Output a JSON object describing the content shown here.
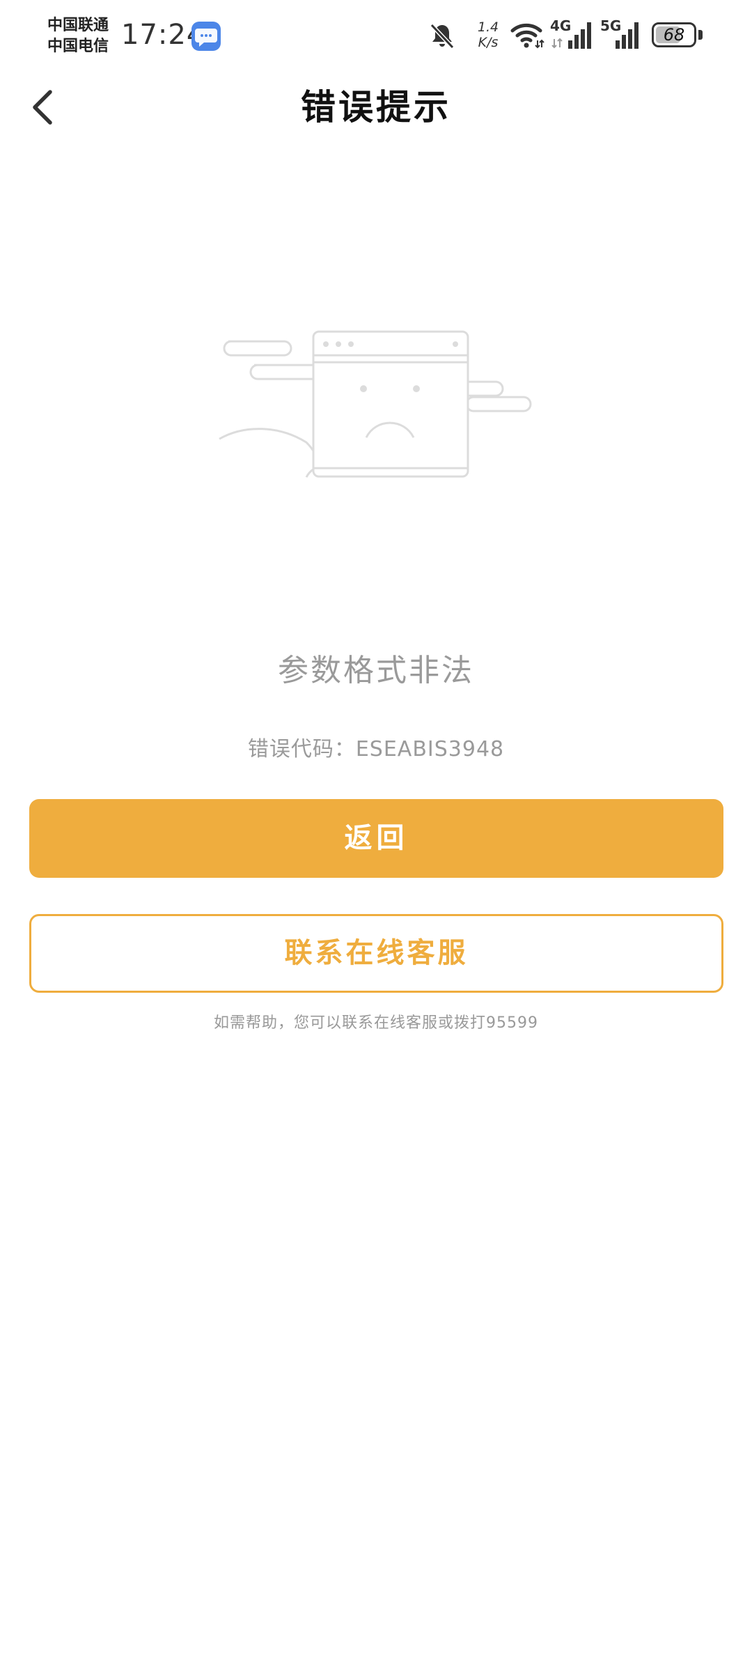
{
  "status_bar": {
    "carrier_1": "中国联通",
    "carrier_2": "中国电信",
    "time": "17:24",
    "net_speed_value": "1.4",
    "net_speed_unit": "K/s",
    "network_1": "4G",
    "network_2": "5G",
    "battery_level": "68",
    "icons": [
      "message-app-icon",
      "bell-muted-icon",
      "wifi-icon",
      "signal-4g-icon",
      "signal-5g-icon",
      "battery-icon"
    ]
  },
  "header": {
    "title": "错误提示",
    "back_icon": "chevron-left-icon"
  },
  "illustration": {
    "icon": "sad-browser-window-icon"
  },
  "error": {
    "message": "参数格式非法",
    "code_label": "错误代码：",
    "code": "ESEABIS3948"
  },
  "actions": {
    "back_label": "返回",
    "contact_label": "联系在线客服"
  },
  "help": {
    "text": "如需帮助，您可以联系在线客服或拨打95599"
  },
  "colors": {
    "accent": "#efad3e",
    "muted_text": "#9a9a9a",
    "illustration_stroke": "#dcdcdc"
  }
}
